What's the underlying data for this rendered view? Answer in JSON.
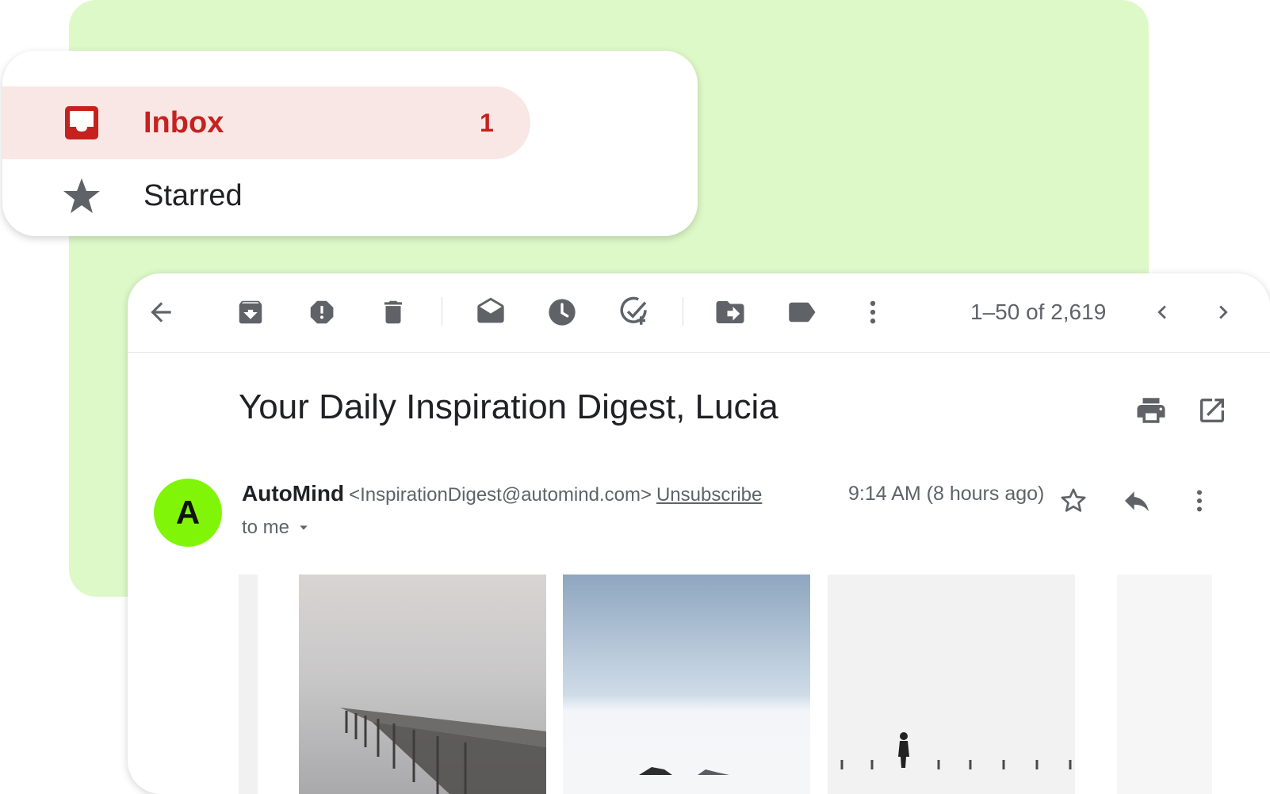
{
  "sidebar": {
    "inbox": {
      "label": "Inbox",
      "count": "1",
      "icon": "inbox-icon",
      "color": "#c5221f"
    },
    "starred": {
      "label": "Starred",
      "icon": "star-icon"
    }
  },
  "toolbar": {
    "icons": [
      "back-arrow-icon",
      "archive-icon",
      "report-spam-icon",
      "delete-icon",
      "mark-unread-icon",
      "snooze-icon",
      "add-to-tasks-icon",
      "move-to-icon",
      "label-icon",
      "more-vert-icon"
    ],
    "page_count": "1–50 of 2,619"
  },
  "email": {
    "subject": "Your Daily Inspiration Digest, Lucia",
    "sender": {
      "initial": "A",
      "name": "AutoMind",
      "email": "<InspirationDigest@automind.com>",
      "unsubscribe": "Unsubscribe",
      "avatar_color": "#80f508"
    },
    "to": "to me",
    "time": "9:14 AM (8 hours ago)"
  },
  "colors": {
    "background_accent": "#def9c8",
    "inbox_highlight": "#f9e7e6"
  }
}
